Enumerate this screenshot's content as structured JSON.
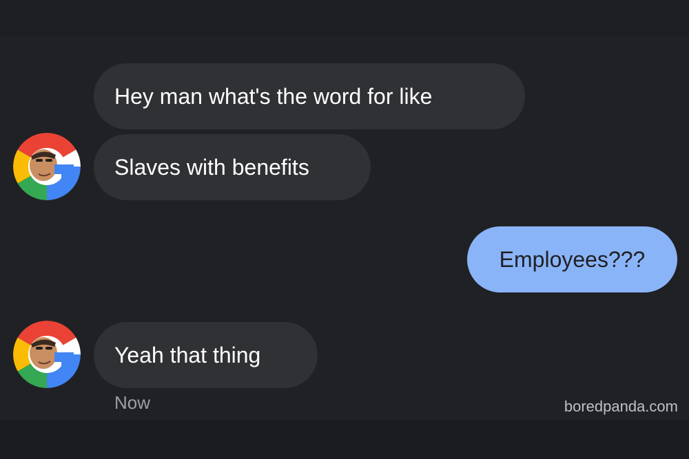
{
  "conversation": {
    "messages": [
      {
        "sender": "contact",
        "text": "Hey man what's the word for like"
      },
      {
        "sender": "contact",
        "text": "Slaves with benefits"
      },
      {
        "sender": "me",
        "text": "Employees???"
      },
      {
        "sender": "contact",
        "text": "Yeah that thing"
      }
    ],
    "timestamp": "Now"
  },
  "contact_avatar": {
    "icon": "google-logo-face-avatar-icon"
  },
  "watermark": "boredpanda.com",
  "colors": {
    "background": "#202124",
    "incoming_bubble": "#303134",
    "outgoing_bubble": "#8ab4f8",
    "incoming_text": "#ffffff",
    "outgoing_text": "#202124",
    "timestamp": "#9aa0a6"
  }
}
